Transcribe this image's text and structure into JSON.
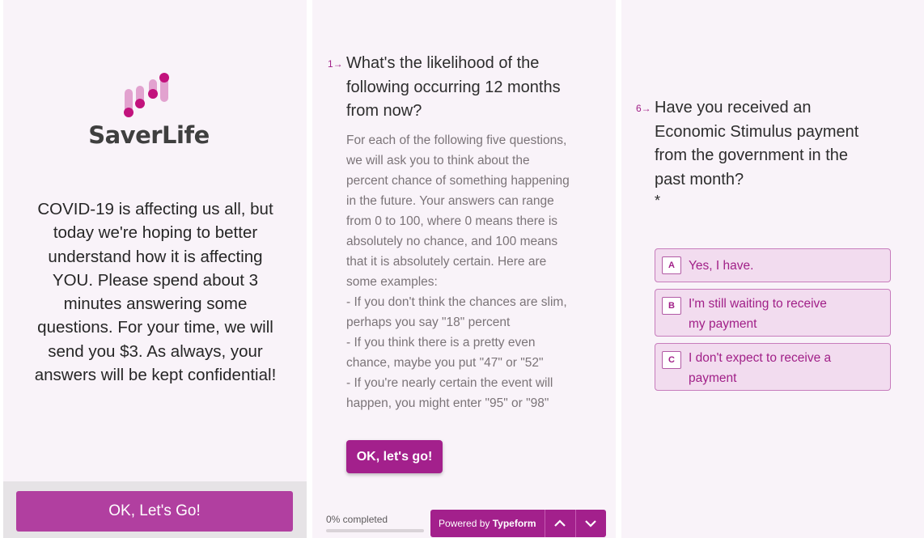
{
  "welcome": {
    "logo_text": "SaverLife",
    "intro_lines": [
      "COVID-19 is affecting us all, but",
      "today we're hoping to better",
      "understand how it is affecting",
      "YOU. Please spend about 3",
      "minutes answering some",
      "questions. For your time, we will",
      "send you $3. As always, your",
      "answers will be kept confidential!"
    ],
    "cta_label": "OK, Let's Go!",
    "colors": {
      "brand": "#b13fa0",
      "logo_dark": "#c2127d",
      "logo_light": "#e2a2cf"
    }
  },
  "question1": {
    "number": "1→",
    "title_lines": [
      "What's the likelihood of the",
      "following occurring 12 months",
      "from now?"
    ],
    "description_lines": [
      "For each of the following five questions,",
      "we will ask you to think about the",
      "percent chance of something happening",
      "in the future. Your answers can range",
      "from 0 to 100, where 0 means there is",
      "absolutely no chance, and 100 means",
      "that it is absolutely certain. Here are",
      "some examples:",
      "- If you don't think the chances are slim,",
      "perhaps you say \"18\" percent",
      "- If you think there is a pretty even",
      "chance, maybe you put \"47\" or \"52\"",
      "- If you're nearly certain the event will",
      "happen, you might enter \"95\" or \"98\""
    ],
    "ok_label": "OK, let's go!"
  },
  "footer": {
    "progress_label": "0% completed",
    "progress_value": 0,
    "powered_prefix": "Powered by",
    "powered_brand": "Typeform",
    "up_icon": "chevron-up-icon",
    "down_icon": "chevron-down-icon"
  },
  "question6": {
    "number": "6→",
    "title_lines": [
      "Have you received an",
      "Economic Stimulus payment",
      "from the government in the",
      "past month?"
    ],
    "required_mark": "*",
    "choices": [
      {
        "key": "A",
        "label_lines": [
          "Yes, I have."
        ]
      },
      {
        "key": "B",
        "label_lines": [
          "I'm still waiting to receive",
          "my payment"
        ]
      },
      {
        "key": "C",
        "label_lines": [
          "I don't expect to receive a",
          "payment"
        ]
      }
    ],
    "accent": "#a12088"
  }
}
